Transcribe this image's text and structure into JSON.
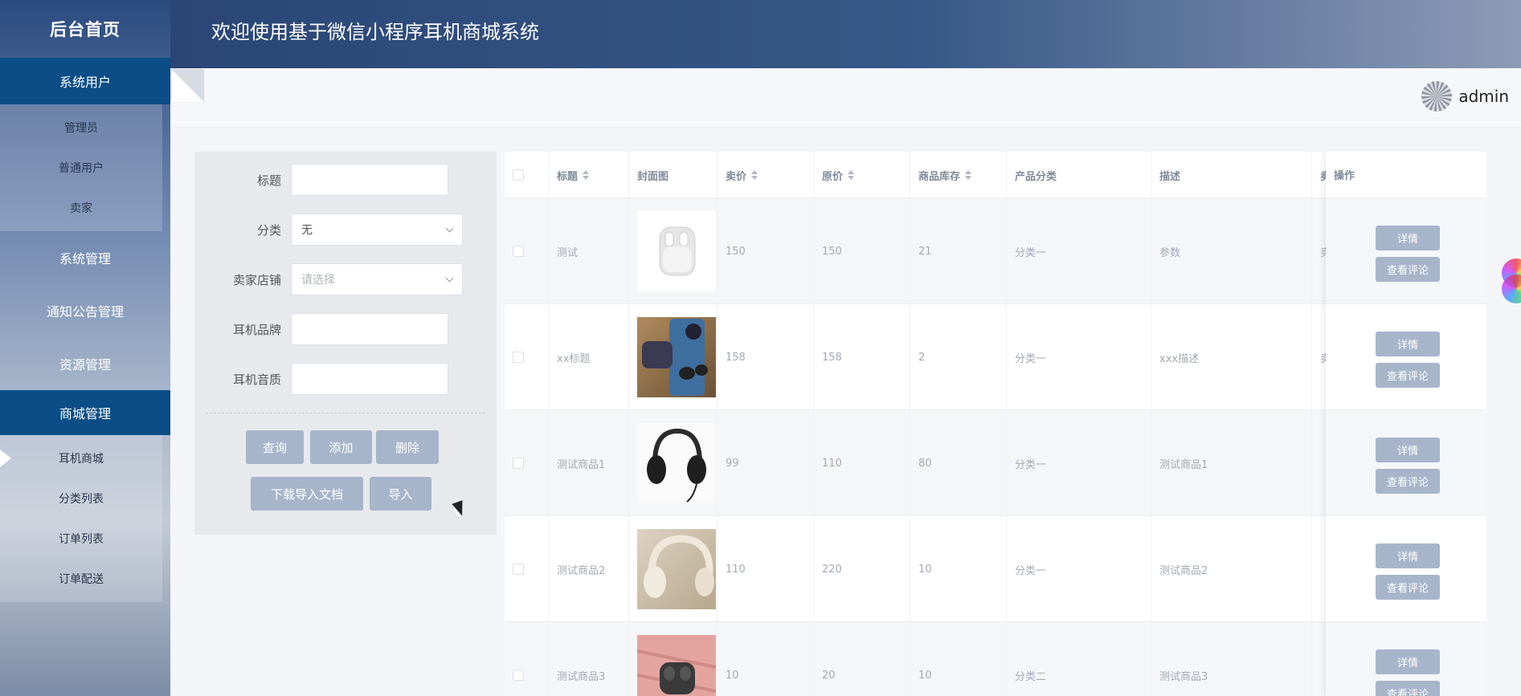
{
  "sidebar": {
    "logo": "后台首页",
    "menus": [
      {
        "label": "系统用户",
        "active": true,
        "items": [
          "管理员",
          "普通用户",
          "卖家"
        ]
      },
      {
        "label": "系统管理"
      },
      {
        "label": "通知公告管理"
      },
      {
        "label": "资源管理"
      },
      {
        "label": "商城管理",
        "active": true,
        "items": [
          "耳机商城",
          "分类列表",
          "订单列表",
          "订单配送"
        ],
        "current": "耳机商城"
      }
    ]
  },
  "header": {
    "title": "欢迎使用基于微信小程序耳机商城系统",
    "username": "admin"
  },
  "search": {
    "title_label": "标题",
    "category_label": "分类",
    "category_value": "无",
    "shop_label": "卖家店铺",
    "shop_placeholder": "请选择",
    "brand_label": "耳机品牌",
    "quality_label": "耳机音质",
    "btn_query": "查询",
    "btn_add": "添加",
    "btn_delete": "删除",
    "btn_download": "下载导入文档",
    "btn_import": "导入"
  },
  "table": {
    "headers": {
      "title": "标题",
      "cover": "封面图",
      "price": "卖价",
      "original": "原价",
      "stock": "商品库存",
      "category": "产品分类",
      "desc": "描述",
      "extra": "卖",
      "ops": "操作"
    },
    "rows": [
      {
        "title": "测试",
        "price": "150",
        "original": "150",
        "stock": "21",
        "category": "分类一",
        "desc": "参数",
        "extra": "卖"
      },
      {
        "title": "xx标题",
        "price": "158",
        "original": "158",
        "stock": "2",
        "category": "分类一",
        "desc": "xxx描述",
        "extra": "卖"
      },
      {
        "title": "测试商品1",
        "price": "99",
        "original": "110",
        "stock": "80",
        "category": "分类一",
        "desc": "测试商品1",
        "extra": ""
      },
      {
        "title": "测试商品2",
        "price": "110",
        "original": "220",
        "stock": "10",
        "category": "分类一",
        "desc": "测试商品2",
        "extra": ""
      },
      {
        "title": "测试商品3",
        "price": "10",
        "original": "20",
        "stock": "10",
        "category": "分类二",
        "desc": "测试商品3",
        "extra": ""
      }
    ],
    "op_detail": "详情",
    "op_comments": "查看评论"
  }
}
